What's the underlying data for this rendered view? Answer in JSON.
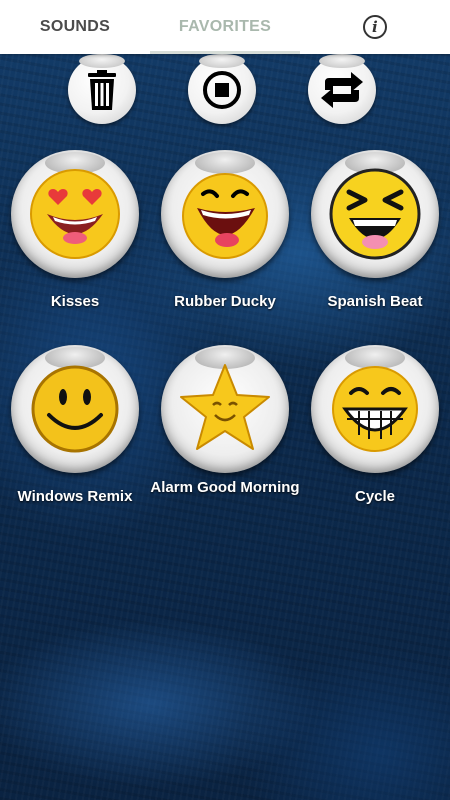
{
  "tabs": {
    "sounds": "SOUNDS",
    "favorites": "FAVORITES",
    "info_icon": "i"
  },
  "controls": [
    {
      "name": "trash-icon"
    },
    {
      "name": "stop-icon"
    },
    {
      "name": "repeat-icon"
    }
  ],
  "sounds": [
    {
      "label": "Kisses",
      "icon": "heart-eyes-emoji-icon"
    },
    {
      "label": "Rubber Ducky",
      "icon": "laughing-emoji-icon"
    },
    {
      "label": "Spanish Beat",
      "icon": "squinting-laugh-emoji-icon"
    },
    {
      "label": "Windows Remix",
      "icon": "smiley-face-icon"
    },
    {
      "label": "Alarm Good Morning",
      "icon": "smiling-star-icon"
    },
    {
      "label": "Cycle",
      "icon": "grinning-teeth-emoji-icon"
    }
  ],
  "colors": {
    "tab_active": "#4b4b4b",
    "tab_inactive": "#a9b8ad",
    "background": "#0c2a4d",
    "emoji_yellow": "#f7c81c"
  }
}
